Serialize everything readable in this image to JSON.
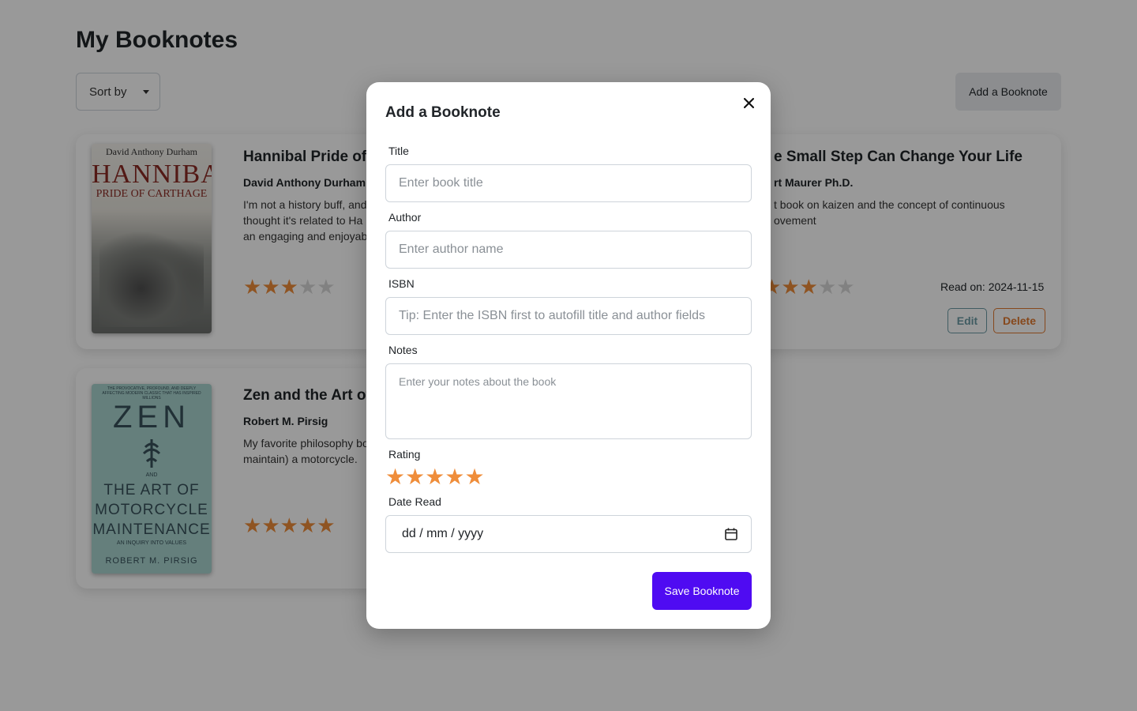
{
  "page": {
    "title": "My Booknotes",
    "sort_label": "Sort by",
    "add_label": "Add a Booknote"
  },
  "books": [
    {
      "title": "Hannibal Pride of C",
      "author": "David Anthony Durham",
      "notes": "I'm not a history buff, and thought it's related to Ha an engaging and enjoyab",
      "rating": 3,
      "cover": {
        "author": "David Anthony Durham",
        "title": "HANNIBAL",
        "subtitle": "PRIDE OF CARTHAGE"
      }
    },
    {
      "title": "e Small Step Can Change Your Life",
      "author": "rt Maurer Ph.D.",
      "notes": "t book on kaizen and the concept of continuous ovement",
      "rating": 3,
      "read_on": "Read on: 2024-11-15",
      "edit_label": "Edit",
      "delete_label": "Delete"
    },
    {
      "title": "Zen and the Art of",
      "author": "Robert M. Pirsig",
      "notes": "My favorite philosophy bo maintain) a motorcycle.",
      "rating": 5,
      "cover": {
        "top_text": "THE PROVOCATIVE, PROFOUND, AND DEEPLY AFFECTING MODERN CLASSIC THAT HAS INSPIRED MILLIONS",
        "title": "ZEN",
        "and": "AND",
        "line1": "THE ART OF",
        "line2": "MOTORCYCLE",
        "line3": "MAINTENANCE",
        "small": "AN INQUIRY INTO VALUES",
        "author": "ROBERT M. PIRSIG"
      }
    }
  ],
  "modal": {
    "title": "Add a Booknote",
    "title_label": "Title",
    "title_placeholder": "Enter book title",
    "author_label": "Author",
    "author_placeholder": "Enter author name",
    "isbn_label": "ISBN",
    "isbn_placeholder": "Tip: Enter the ISBN first to autofill title and author fields",
    "notes_label": "Notes",
    "notes_placeholder": "Enter your notes about the book",
    "rating_label": "Rating",
    "rating_value": 5,
    "date_label": "Date Read",
    "date_placeholder": "dd / mm / yyyy",
    "save_label": "Save Booknote"
  },
  "colors": {
    "star_on": "#ef8d3a",
    "star_off": "#d8d8d8",
    "save_bg": "#4f0bf2",
    "edit": "#6c9aa4",
    "delete": "#e0782f"
  },
  "icons": [
    "close-icon",
    "calendar-icon",
    "star-icon",
    "caret-down-icon"
  ]
}
